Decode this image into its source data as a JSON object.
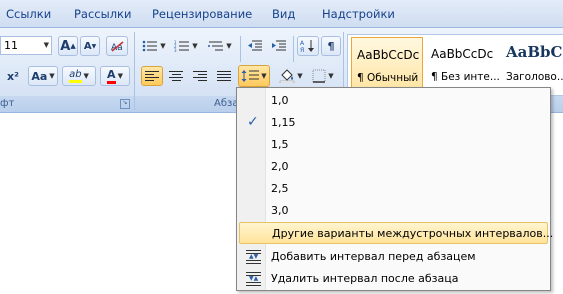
{
  "tabs": [
    "Ссылки",
    "Рассылки",
    "Рецензирование",
    "Вид",
    "Надстройки"
  ],
  "font": {
    "size_value": "11",
    "grow_label": "A",
    "shrink_label": "A",
    "clear_icon": "clear-formatting-icon",
    "superscript_label": "x²",
    "case_label": "Aa",
    "highlight_label": "ab",
    "font_color_label": "A",
    "group_label": "фт"
  },
  "paragraph": {
    "group_label": "Абзац",
    "pilcrow": "¶"
  },
  "styles": [
    {
      "sample": "AaBbCcDc",
      "name": "¶ Обычный",
      "selected": true
    },
    {
      "sample": "AaBbCcDc",
      "name": "¶ Без инте...",
      "selected": false
    },
    {
      "sample": "AaBbCc",
      "name": "Заголово...",
      "selected": false
    }
  ],
  "menu": {
    "spacing_options": [
      "1,0",
      "1,15",
      "1,5",
      "2,0",
      "2,5",
      "3,0"
    ],
    "checked_option": "1,15",
    "check_mark": "✓",
    "more_options": "Другие варианты междустрочных интервалов...",
    "add_before": "Добавить интервал перед абзацем",
    "remove_after": "Удалить интервал после абзаца"
  },
  "colors": {
    "highlight": "#ffff00",
    "font_color": "#ff0000",
    "active_button": "#ffc95c"
  }
}
